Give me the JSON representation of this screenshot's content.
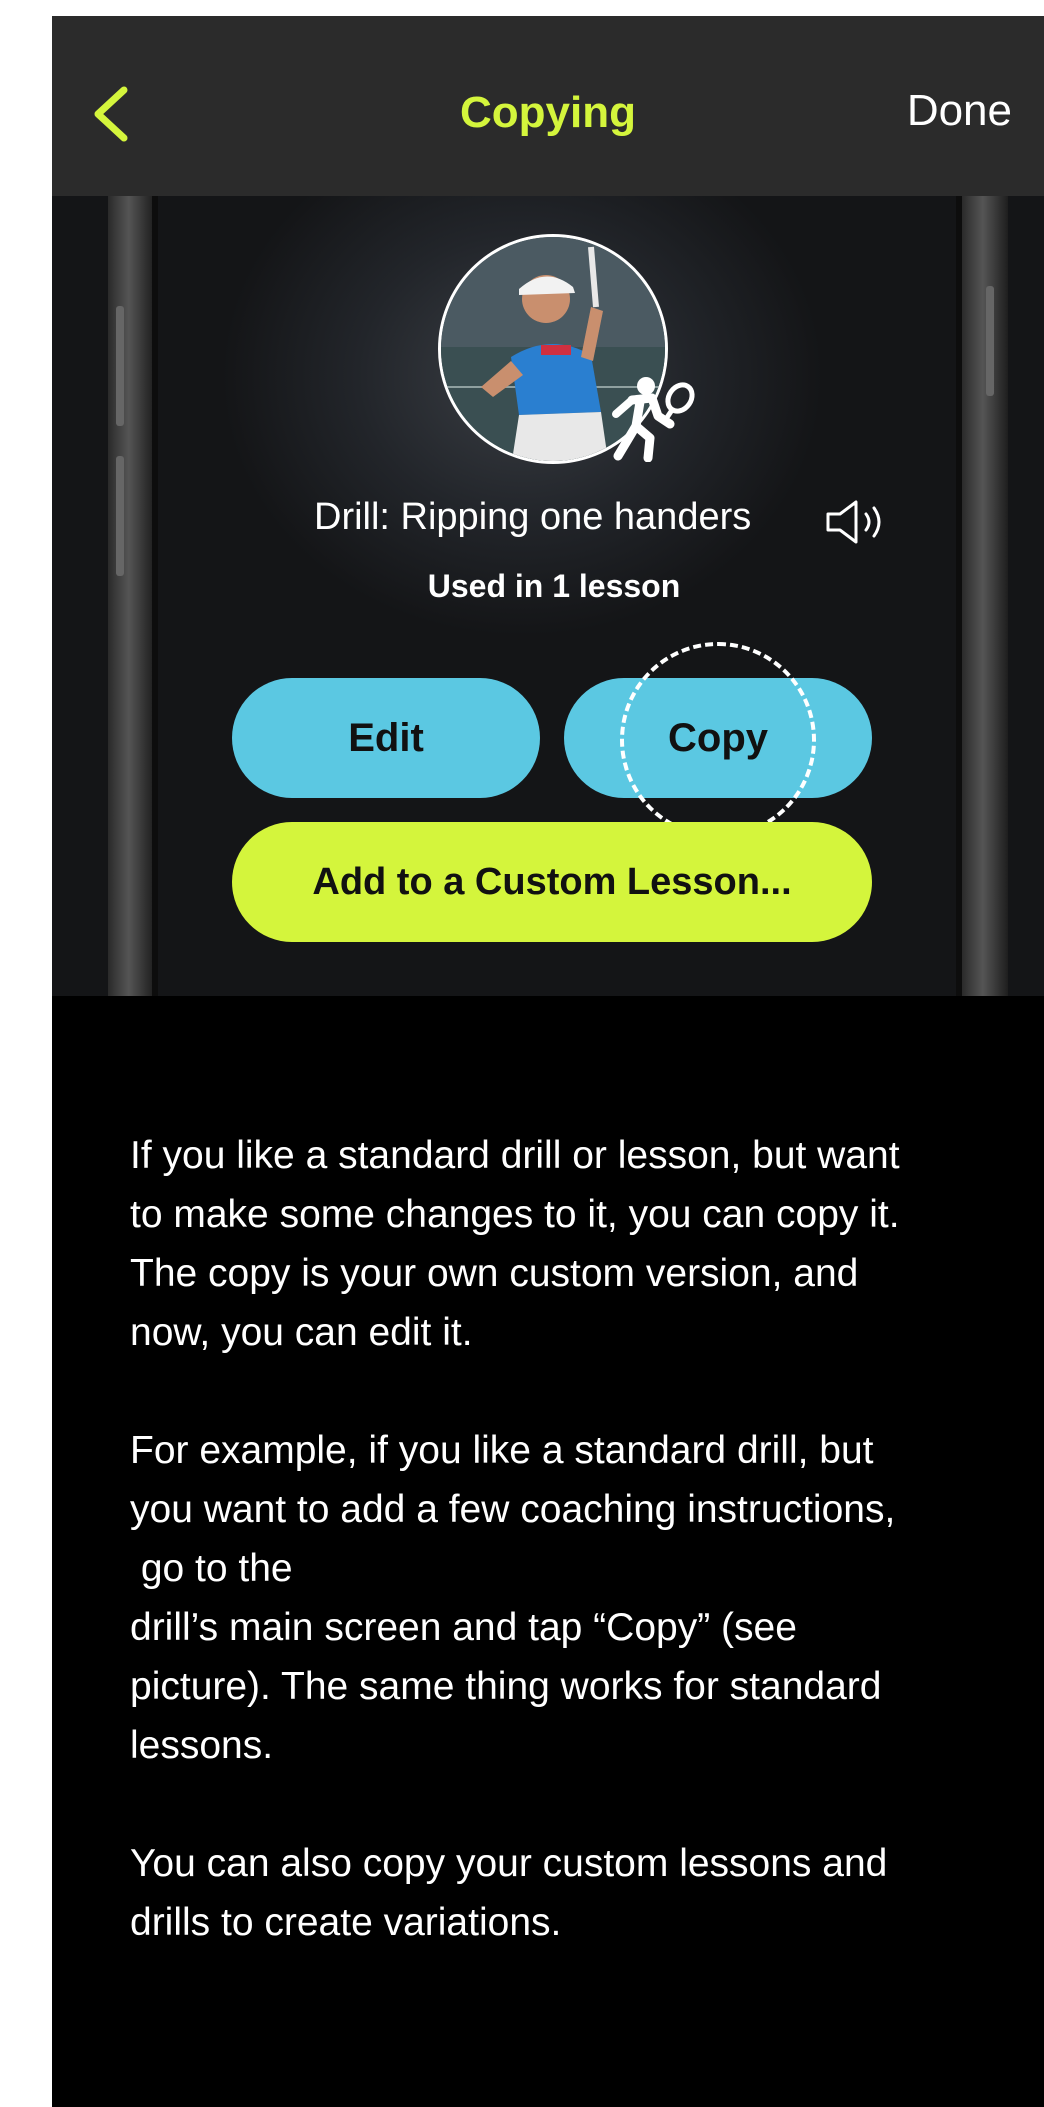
{
  "navbar": {
    "back_icon": "chevron-left-icon",
    "title": "Copying",
    "done_label": "Done",
    "accent_color": "#d4f53c"
  },
  "drill_card": {
    "avatar_icon": "tennis-player-icon",
    "title": "Drill: Ripping one handers",
    "speaker_icon": "speaker-icon",
    "used_in": "Used in 1 lesson",
    "edit_label": "Edit",
    "copy_label": "Copy",
    "add_label": "Add to a Custom Lesson...",
    "button_color": "#5bc8e2"
  },
  "body": {
    "para1": [
      "If you like a standard drill or lesson, but want",
      "to make some changes to it, you can copy it.",
      "The copy is your own custom version, and",
      "now, you can edit it."
    ],
    "para2": [
      "For example, if you like a standard drill, but",
      "you want to add a few coaching instructions,",
      " go to the",
      "drill’s main screen and tap “Copy” (see",
      "picture). The same thing works for standard",
      "lessons."
    ],
    "para3": [
      "You can also copy your custom lessons and",
      "drills to create variations."
    ]
  }
}
